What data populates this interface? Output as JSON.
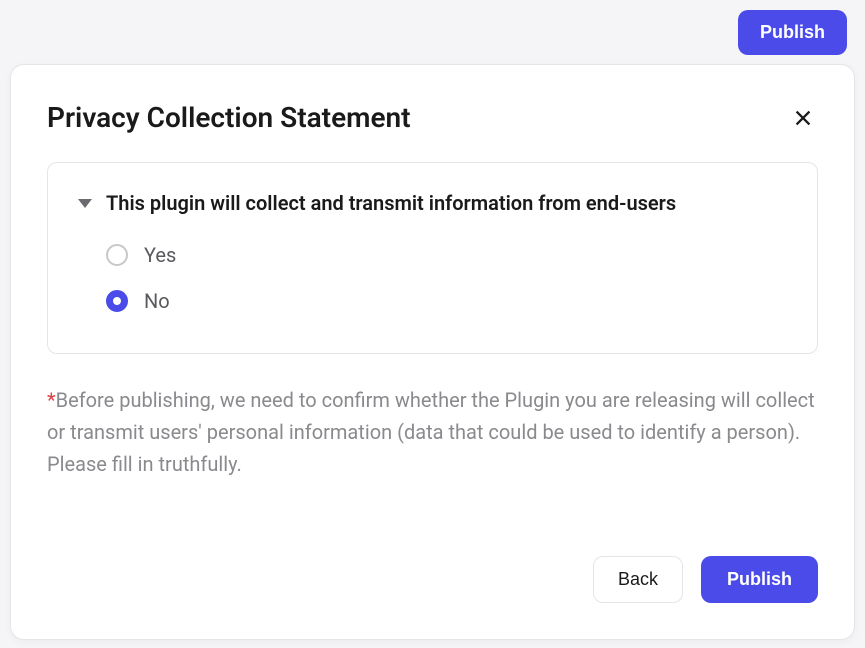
{
  "topbar": {
    "publish_label": "Publish"
  },
  "modal": {
    "title": "Privacy Collection Statement",
    "card": {
      "heading": "This plugin will collect and transmit information from end-users",
      "options": {
        "yes_label": "Yes",
        "no_label": "No",
        "selected": "no"
      }
    },
    "disclaimer_asterisk": "*",
    "disclaimer_text": "Before publishing, we need to confirm whether the Plugin you are releasing will collect or transmit users' personal information (data that could be used to identify a person). Please fill in truthfully.",
    "footer": {
      "back_label": "Back",
      "publish_label": "Publish"
    }
  }
}
